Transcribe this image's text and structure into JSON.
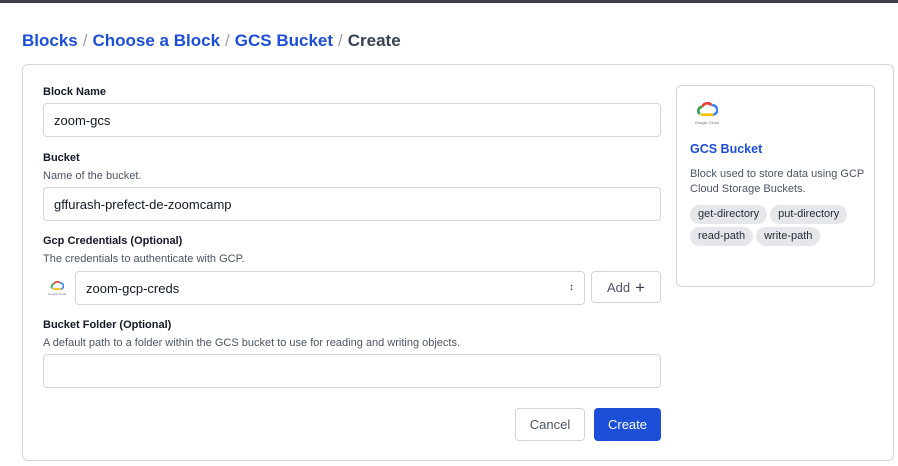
{
  "breadcrumb": {
    "items": [
      "Blocks",
      "Choose a Block",
      "GCS Bucket"
    ],
    "current": "Create",
    "separator": "/"
  },
  "form": {
    "block_name": {
      "label": "Block Name",
      "value": "zoom-gcs"
    },
    "bucket": {
      "label": "Bucket",
      "description": "Name of the bucket.",
      "value": "gffurash-prefect-de-zoomcamp"
    },
    "gcp_credentials": {
      "label": "Gcp Credentials (Optional)",
      "description": "The credentials to authenticate with GCP.",
      "selected": "zoom-gcp-creds",
      "logo_text": "Google Cloud",
      "add_label": "Add"
    },
    "bucket_folder": {
      "label": "Bucket Folder (Optional)",
      "description": "A default path to a folder within the GCS bucket to use for reading and writing objects.",
      "value": ""
    },
    "cancel_label": "Cancel",
    "create_label": "Create"
  },
  "block_info": {
    "logo_text": "Google Cloud",
    "title": "GCS Bucket",
    "description": "Block used to store data using GCP Cloud Storage Buckets.",
    "capabilities": [
      "get-directory",
      "put-directory",
      "read-path",
      "write-path"
    ]
  },
  "colors": {
    "accent": "#1d4ed8",
    "border": "#d1d5db",
    "tag_bg": "#e5e7eb",
    "gcp_blue": "#4285F4",
    "gcp_red": "#EA4335",
    "gcp_yellow": "#FBBC04",
    "gcp_green": "#34A853"
  },
  "icons": {
    "logo": "google-cloud-icon",
    "select": "chevron-updown-icon",
    "add": "plus-icon"
  }
}
